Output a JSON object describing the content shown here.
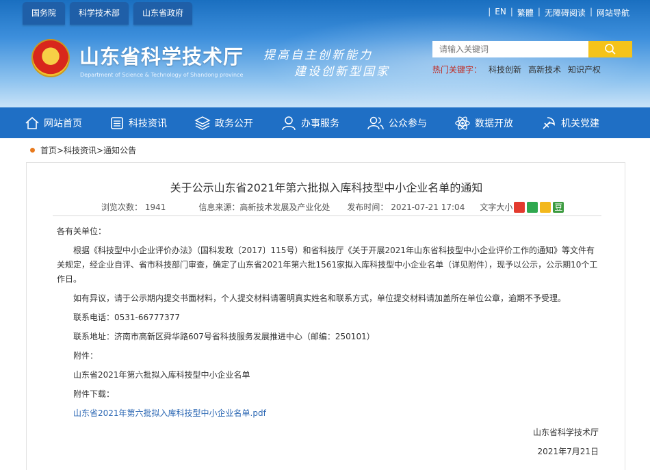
{
  "top_tabs": [
    "国务院",
    "科学技术部",
    "山东省政府"
  ],
  "top_links": [
    "EN",
    "繁體",
    "无障碍阅读",
    "网站导航"
  ],
  "site": {
    "title": "山东省科学技术厅",
    "subtitle": "Department of Science & Technology of Shandong province",
    "slogan_line1": "提高自主创新能力",
    "slogan_line2": "建设创新型国家"
  },
  "search": {
    "placeholder": "请输入关键词",
    "hot_label": "热门关键字：",
    "hot_words": [
      "科技创新",
      "高新技术",
      "知识产权"
    ]
  },
  "nav": [
    {
      "label": "网站首页",
      "icon": "home-icon"
    },
    {
      "label": "科技资讯",
      "icon": "news-icon"
    },
    {
      "label": "政务公开",
      "icon": "layers-icon"
    },
    {
      "label": "办事服务",
      "icon": "user-service-icon"
    },
    {
      "label": "公众参与",
      "icon": "people-icon"
    },
    {
      "label": "数据开放",
      "icon": "atom-icon"
    },
    {
      "label": "机关党建",
      "icon": "party-icon"
    }
  ],
  "breadcrumb": "首页>科技资讯>通知公告",
  "article": {
    "title": "关于公示山东省2021年第六批拟入库科技型中小企业名单的通知",
    "views": "浏览次数： 1941",
    "source": "信息来源：高新技术发展及产业化处",
    "publish_time": "发布时间： 2021-07-21 17:04",
    "font_size_label": "文字大小：",
    "salutation": "各有关单位：",
    "para1": "根据《科技型中小企业评价办法》（国科发政〔2017〕115号）和省科技厅《关于开展2021年山东省科技型中小企业评价工作的通知》等文件有关规定，经企业自评、省市科技部门审查，确定了山东省2021年第六批1561家拟入库科技型中小企业名单（详见附件），现予以公示，公示期10个工作日。",
    "para2": "如有异议，请于公示期内提交书面材料，个人提交材料请署明真实姓名和联系方式，单位提交材料请加盖所在单位公章，逾期不予受理。",
    "phone": "联系电话：0531-66777377",
    "address": "联系地址：济南市高新区舜华路607号省科技服务发展推进中心（邮编：250101）",
    "attachment_label": "附件：",
    "attachment_name": "山东省2021年第六批拟入库科技型中小企业名单",
    "download_label": "附件下载：",
    "download_link": "山东省2021年第六批拟入库科技型中小企业名单.pdf",
    "signature": "山东省科学技术厅",
    "date": "2021年7月21日"
  },
  "colors": {
    "nav_bg": "#1f6fc5",
    "tab_bg": "#1f5fa8",
    "search_btn": "#f5c31a",
    "hot_label": "#c0281f",
    "link": "#2a66b3",
    "bullet": "#e87a1e"
  }
}
